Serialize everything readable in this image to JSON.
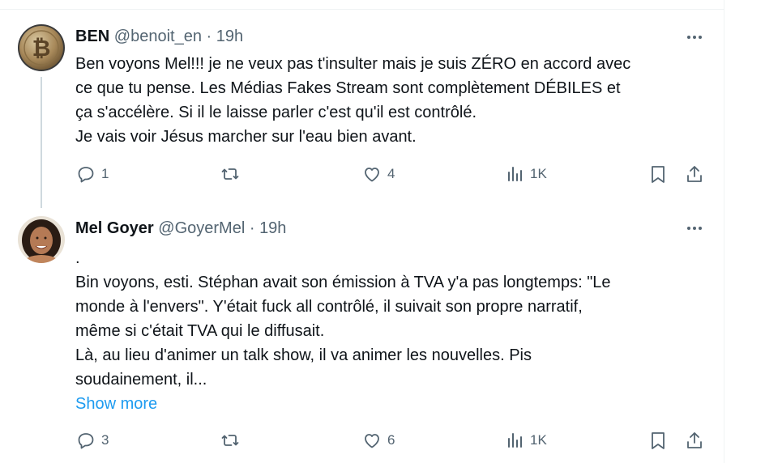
{
  "tweets": [
    {
      "name": "BEN",
      "handle": "@benoit_en",
      "time": "19h",
      "avatar": "bitcoin-avatar",
      "lines": [
        "Ben voyons Mel!!! je ne veux pas t'insulter mais je suis ZÉRO en accord avec",
        "ce que tu pense.  Les Médias Fakes Stream sont complètement DÉBILES et",
        "ça s'accélère. Si il le laisse parler c'est qu'il est contrôlé.",
        "Je vais voir Jésus marcher sur l'eau bien avant."
      ],
      "replies": "1",
      "retweets": "",
      "likes": "4",
      "views": "1K"
    },
    {
      "name": "Mel Goyer",
      "handle": "@GoyerMel",
      "time": "19h",
      "avatar": "woman-photo-avatar",
      "lines": [
        ".",
        "Bin voyons, esti. Stéphan avait son émission à TVA y'a pas longtemps: \"Le",
        "monde à l'envers\". Y'était fuck all contrôlé, il suivait son propre narratif,",
        "même si c'était TVA qui le diffusait.",
        "Là, au lieu d'animer un talk show, il va animer les nouvelles. Pis",
        "soudainement, il..."
      ],
      "show_more": "Show more",
      "replies": "3",
      "retweets": "",
      "likes": "6",
      "views": "1K"
    }
  ],
  "separator": "·",
  "colors": {
    "text": "#0f1419",
    "muted": "#536471",
    "link": "#1d9bf0",
    "border": "#cfd9de"
  },
  "icons": [
    "reply-icon",
    "retweet-icon",
    "like-icon",
    "views-icon",
    "bookmark-icon",
    "share-icon",
    "more-icon"
  ]
}
